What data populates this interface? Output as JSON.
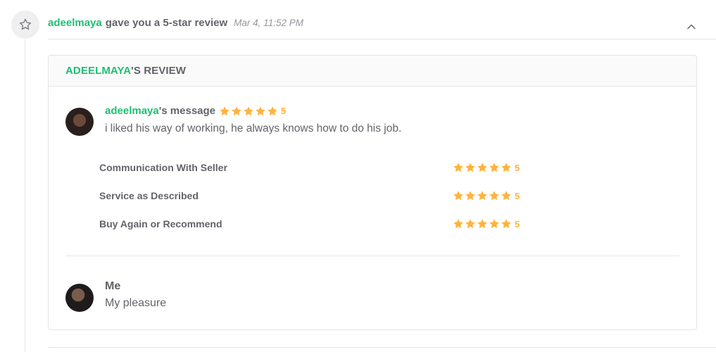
{
  "event": {
    "icon": "star-outline-icon",
    "user": "adeelmaya",
    "text": "gave you a 5-star review",
    "time": "Mar 4, 11:52 PM",
    "collapse_icon": "chevron-up-icon"
  },
  "review": {
    "title_user": "ADEELMAYA",
    "title_suffix": "'S REVIEW",
    "buyer": {
      "name": "adeelmaya",
      "suffix": "'s message",
      "rating": 5,
      "rating_label": "5",
      "message": "i liked his way of working, he always knows how to do his job.",
      "avatar": "buyer-avatar"
    },
    "breakdown": [
      {
        "label": "Communication With Seller",
        "rating": 5,
        "rating_label": "5"
      },
      {
        "label": "Service as Described",
        "rating": 5,
        "rating_label": "5"
      },
      {
        "label": "Buy Again or Recommend",
        "rating": 5,
        "rating_label": "5"
      }
    ],
    "reply": {
      "name": "Me",
      "message": "My pleasure",
      "avatar": "seller-avatar"
    }
  },
  "colors": {
    "accent": "#1dbf73",
    "star": "#ffb33e",
    "text": "#62646a",
    "muted": "#95979d",
    "border": "#e4e5e7"
  }
}
